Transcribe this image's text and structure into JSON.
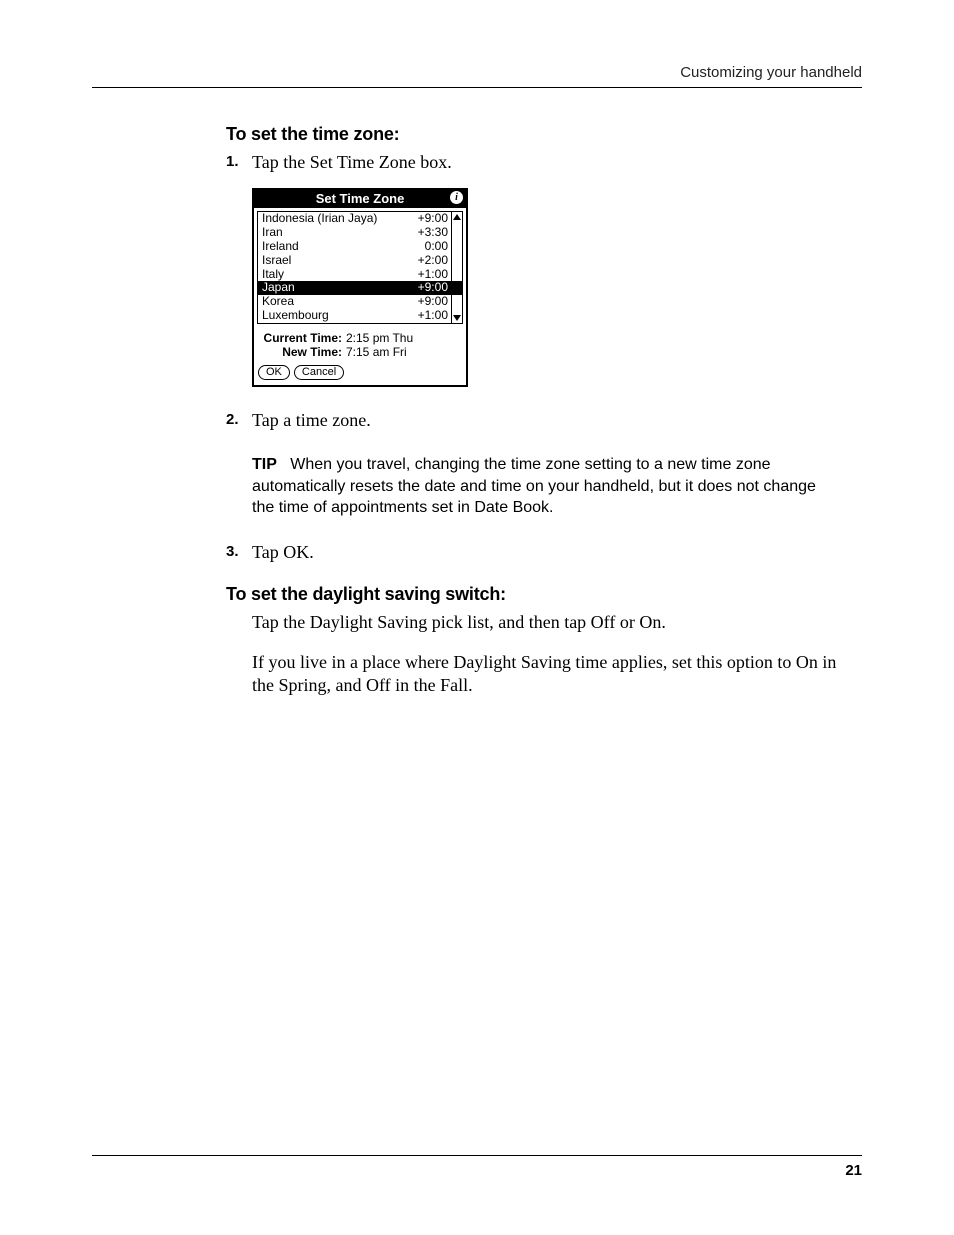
{
  "header": {
    "running_head": "Customizing your handheld"
  },
  "sections": {
    "set_tz": {
      "heading": "To set the time zone:",
      "step1": {
        "num": "1.",
        "text": "Tap the Set Time Zone box."
      },
      "step2": {
        "num": "2.",
        "text": "Tap a time zone."
      },
      "step3": {
        "num": "3.",
        "text": "Tap OK."
      },
      "tip_label": "TIP",
      "tip_body": "When you travel, changing the time zone setting to a new time zone automatically resets the date and time on your handheld, but it does not change the time of appointments set in Date Book."
    },
    "set_dst": {
      "heading": "To set the daylight saving switch:",
      "p1": "Tap the Daylight Saving pick list, and then tap Off or On.",
      "p2": "If you live in a place where Daylight Saving time applies, set this option to On in the Spring, and Off in the Fall."
    }
  },
  "palm": {
    "title": "Set Time Zone",
    "zones": [
      {
        "name": "Indonesia (Irian Jaya)",
        "offset": "+9:00"
      },
      {
        "name": "Iran",
        "offset": "+3:30"
      },
      {
        "name": "Ireland",
        "offset": "0:00"
      },
      {
        "name": "Israel",
        "offset": "+2:00"
      },
      {
        "name": "Italy",
        "offset": "+1:00"
      },
      {
        "name": "Japan",
        "offset": "+9:00"
      },
      {
        "name": "Korea",
        "offset": "+9:00"
      },
      {
        "name": "Luxembourg",
        "offset": "+1:00"
      }
    ],
    "selected_index": 5,
    "current_label": "Current Time:",
    "current_value": "2:15 pm Thu",
    "new_label": "New Time:",
    "new_value": "7:15 am Fri",
    "ok": "OK",
    "cancel": "Cancel"
  },
  "footer": {
    "page_number": "21"
  }
}
